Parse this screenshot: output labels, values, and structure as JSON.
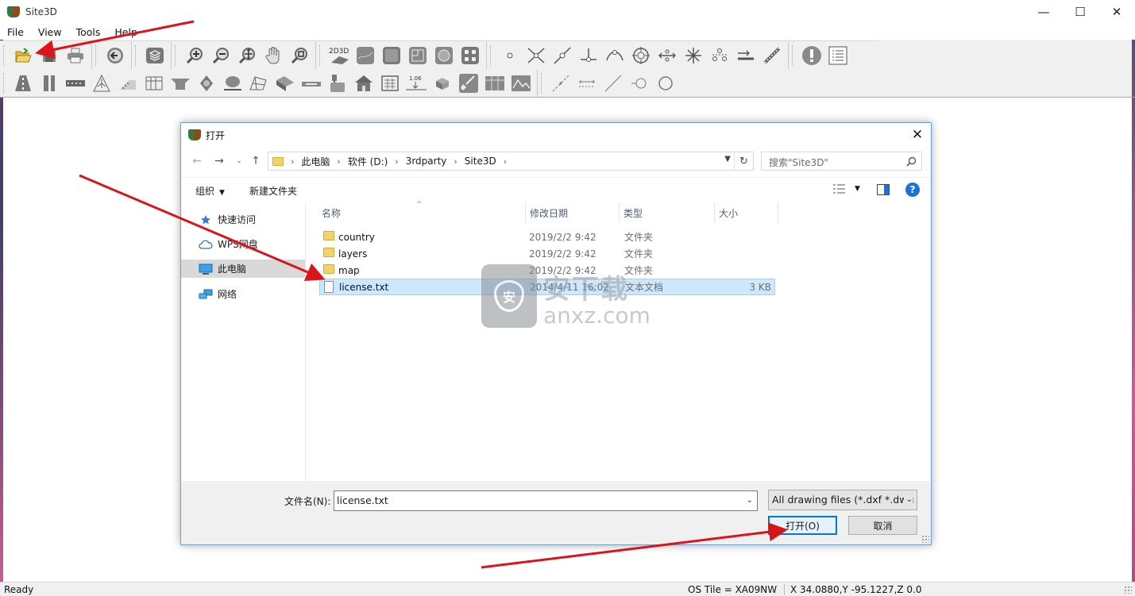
{
  "app": {
    "title": "Site3D",
    "window_controls": {
      "minimize": "—",
      "maximize": "☐",
      "close": "✕"
    }
  },
  "menu": [
    "File",
    "View",
    "Tools",
    "Help"
  ],
  "toolbar1": {
    "groups": [
      [
        "open-icon",
        "save-icon",
        "print-icon"
      ],
      [
        "back-icon"
      ],
      [
        "layers-icon"
      ],
      [
        "zoom-in-icon",
        "zoom-out-icon",
        "zoom-extents-icon",
        "pan-icon",
        "zoom-window-icon"
      ],
      [
        "2d3d-icon",
        "terrain-icon",
        "surface-icon",
        "sheet-icon",
        "globe-icon",
        "grid-icon"
      ],
      [
        "point-icon",
        "intersect-icon",
        "line-point-icon",
        "perpendicular-icon",
        "arc-icon",
        "target-icon",
        "dimension-icon",
        "star-icon",
        "stakeout-icon",
        "offset-icon",
        "survey-icon"
      ],
      [
        "warning-icon",
        "list-icon"
      ]
    ],
    "label_2d3d": "2D3D"
  },
  "toolbar2": {
    "groups": [
      [
        "road-icon",
        "kerb-icon",
        "rail-icon",
        "junction-icon",
        "slope-icon",
        "building-icon",
        "channel-icon",
        "manhole-icon",
        "pit-icon",
        "plane-icon",
        "ramp-icon",
        "culvert-icon",
        "tank-icon",
        "house-icon",
        "panel-icon",
        "level-icon",
        "box-icon",
        "shovel-icon",
        "wall-icon",
        "profile-icon"
      ],
      [
        "dashed-line-icon",
        "dim-line-icon",
        "diag-line-icon",
        "circle-point-icon",
        "circle-icon"
      ]
    ],
    "level_label": "1.06"
  },
  "status": {
    "ready": "Ready",
    "tile": "OS Tile = XA09NW",
    "coords": "X 34.0880,Y -95.1227,Z 0.0"
  },
  "dialog": {
    "title": "打开",
    "breadcrumb": [
      "此电脑",
      "软件 (D:)",
      "3rdparty",
      "Site3D"
    ],
    "search_placeholder": "搜索\"Site3D\"",
    "organize": "组织",
    "new_folder": "新建文件夹",
    "nav": [
      {
        "label": "快速访问",
        "icon": "star-icon"
      },
      {
        "label": "WPS网盘",
        "icon": "cloud-icon"
      },
      {
        "label": "此电脑",
        "icon": "computer-icon"
      },
      {
        "label": "网络",
        "icon": "network-icon"
      }
    ],
    "columns": {
      "name": "名称",
      "date": "修改日期",
      "type": "类型",
      "size": "大小"
    },
    "files": [
      {
        "name": "country",
        "date": "2019/2/2 9:42",
        "type": "文件夹",
        "size": "",
        "kind": "folder"
      },
      {
        "name": "layers",
        "date": "2019/2/2 9:42",
        "type": "文件夹",
        "size": "",
        "kind": "folder"
      },
      {
        "name": "map",
        "date": "2019/2/2 9:42",
        "type": "文件夹",
        "size": "",
        "kind": "folder"
      },
      {
        "name": "license.txt",
        "date": "2014/4/11 16:02",
        "type": "文本文档",
        "size": "3 KB",
        "kind": "file"
      }
    ],
    "filename_label": "文件名(N):",
    "filename_value": "license.txt",
    "filetype": "All drawing files (*.dxf *.dwg",
    "open_label": "打开(O)",
    "cancel_label": "取消"
  },
  "watermark": {
    "text_cn": "安下载",
    "text_en": "anxz.com",
    "badge": "安"
  },
  "colors": {
    "arrow": "#d9141b",
    "selection": "#cce8ff",
    "accent": "#0078d7"
  }
}
